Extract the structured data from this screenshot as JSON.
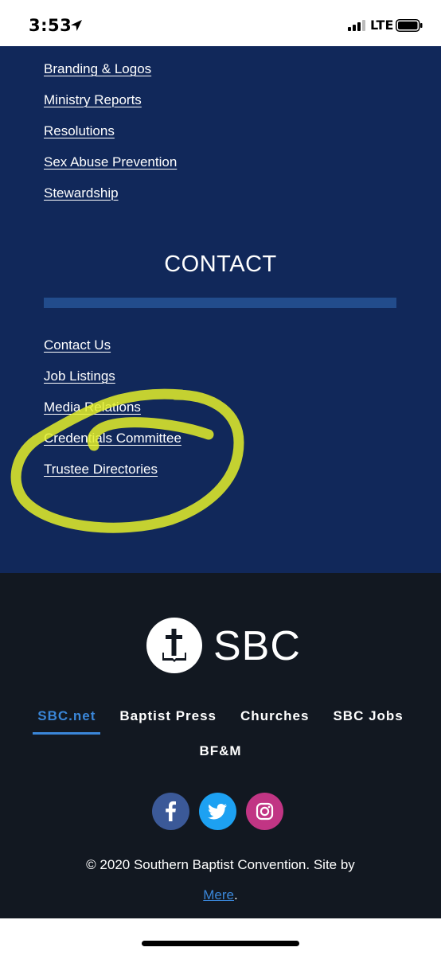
{
  "status_bar": {
    "time": "3:53",
    "network": "LTE"
  },
  "resources_links": [
    {
      "label": "Branding & Logos"
    },
    {
      "label": "Ministry Reports"
    },
    {
      "label": "Resolutions"
    },
    {
      "label": "Sex Abuse Prevention"
    },
    {
      "label": "Stewardship"
    }
  ],
  "contact": {
    "title": "CONTACT",
    "links": [
      {
        "label": "Contact Us"
      },
      {
        "label": "Job Listings"
      },
      {
        "label": "Media Relations"
      },
      {
        "label": "Credentials Committee"
      },
      {
        "label": "Trustee Directories"
      }
    ]
  },
  "footer": {
    "logo_text": "SBC",
    "nav": [
      {
        "label": "SBC.net",
        "active": true
      },
      {
        "label": "Baptist Press"
      },
      {
        "label": "Churches"
      },
      {
        "label": "SBC Jobs"
      }
    ],
    "nav_second_row": {
      "label": "BF&M"
    },
    "social": [
      {
        "icon": "facebook-icon",
        "color": "#3b5998"
      },
      {
        "icon": "twitter-icon",
        "color": "#1da1f2"
      },
      {
        "icon": "instagram-icon",
        "color": "#c13584"
      }
    ],
    "copyright": "© 2020 Southern Baptist Convention. Site by",
    "site_by_link": "Mere",
    "site_by_suffix": "."
  },
  "colors": {
    "navy_background": "#11285a",
    "footer_background": "#121821",
    "accent": "#3a86d8",
    "highlight": "#e4ef2a"
  }
}
